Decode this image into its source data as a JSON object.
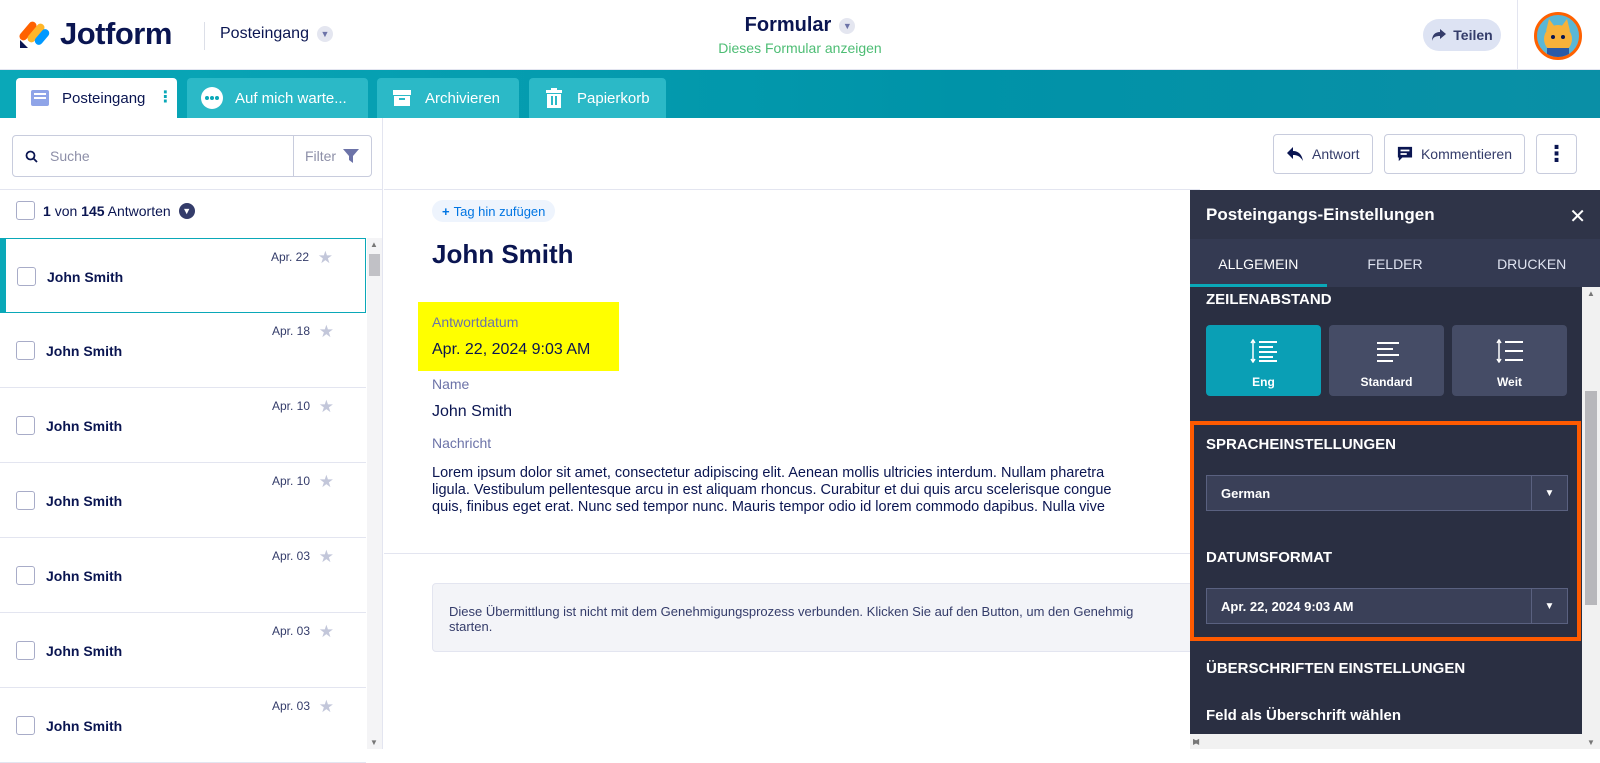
{
  "header": {
    "logo_text": "Jotform",
    "inbox_label": "Posteingang",
    "form_title": "Formular",
    "form_link": "Dieses Formular anzeigen",
    "share_label": "Teilen"
  },
  "tabs": [
    {
      "label": "Posteingang"
    },
    {
      "label": "Auf mich warte..."
    },
    {
      "label": "Archivieren"
    },
    {
      "label": "Papierkorb"
    }
  ],
  "search": {
    "placeholder": "Suche",
    "filter_label": "Filter"
  },
  "counter": {
    "current": "1",
    "von": "von",
    "total": "145",
    "suffix": "Antworten"
  },
  "list": [
    {
      "name": "John Smith",
      "date": "Apr. 22"
    },
    {
      "name": "John Smith",
      "date": "Apr. 18"
    },
    {
      "name": "John Smith",
      "date": "Apr. 10"
    },
    {
      "name": "John Smith",
      "date": "Apr. 10"
    },
    {
      "name": "John Smith",
      "date": "Apr. 03"
    },
    {
      "name": "John Smith",
      "date": "Apr. 03"
    },
    {
      "name": "John Smith",
      "date": "Apr. 03"
    }
  ],
  "toolbar": {
    "reply_label": "Antwort",
    "comment_label": "Kommentieren"
  },
  "submission": {
    "tag_label": "Tag hin zufügen",
    "name": "John Smith",
    "date_label": "Antwortdatum",
    "date_value": "Apr. 22, 2024 9:03 AM",
    "name_label": "Name",
    "name_value": "John Smith",
    "message_label": "Nachricht",
    "message_lines": [
      "Lorem ipsum dolor sit amet, consectetur adipiscing elit. Aenean mollis ultricies interdum. Nullam pharetra",
      "ligula. Vestibulum pellentesque arcu in est aliquam rhoncus. Curabitur et dui quis arcu scelerisque congue",
      "quis, finibus eget erat. Nunc sed tempor nunc. Mauris tempor odio id lorem commodo dapibus. Nulla vive"
    ],
    "notice_lines": [
      "Diese Übermittlung ist nicht mit dem Genehmigungsprozess verbunden. Klicken Sie auf den Button, um den Genehmig",
      "starten."
    ]
  },
  "panel": {
    "title": "Posteingangs-Einstellungen",
    "tabs": [
      "ALLGEMEIN",
      "FELDER",
      "DRUCKEN"
    ],
    "line_spacing_title": "ZEILENABSTAND",
    "spacing_options": [
      "Eng",
      "Standard",
      "Weit"
    ],
    "language_title": "SPRACHEINSTELLUNGEN",
    "language_value": "German",
    "date_format_title": "DATUMSFORMAT",
    "date_format_value": "Apr. 22, 2024 9:03 AM",
    "headings_title": "ÜBERSCHRIFTEN EINSTELLUNGEN",
    "field_heading_label": "Feld als Überschrift wählen"
  },
  "colors": {
    "accent": "#0aa8b8",
    "highlight": "#ffff00",
    "outline": "#ff5a00",
    "panel": "#2a2f42"
  }
}
